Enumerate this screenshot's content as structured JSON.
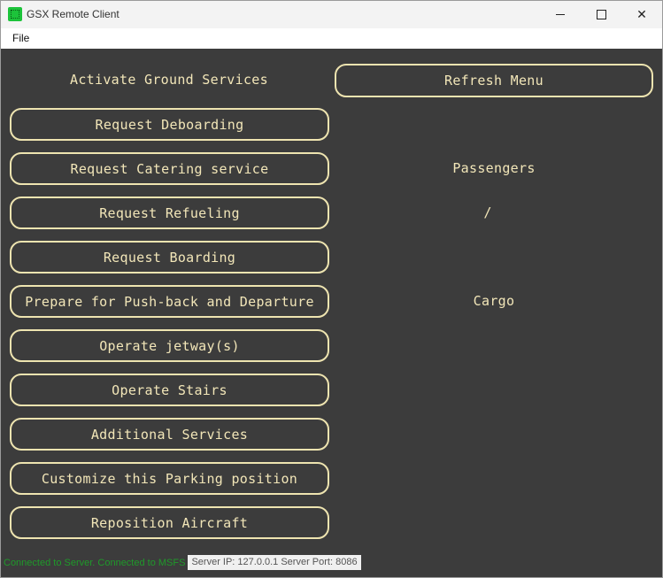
{
  "window": {
    "title": "GSX Remote Client"
  },
  "menu": {
    "file": "File"
  },
  "header_label": "Activate Ground Services",
  "refresh_button": "Refresh Menu",
  "menu_items": [
    "Request Deboarding",
    "Request Catering service",
    "Request Refueling",
    "Request Boarding",
    "Prepare for Push-back and Departure",
    "Operate jetway(s)",
    "Operate Stairs",
    "Additional Services",
    "Customize this Parking position",
    "Reposition Aircraft"
  ],
  "info": {
    "passengers_label": "Passengers",
    "passengers_value": "/",
    "cargo_label": "Cargo"
  },
  "status": {
    "connection": "Connected to Server. Connected to MSFS",
    "server": "Server IP: 127.0.0.1  Server Port: 8086"
  },
  "colors": {
    "accent": "#f2e6b8",
    "background": "#3c3c3c",
    "status_green": "#1f9a2a"
  }
}
